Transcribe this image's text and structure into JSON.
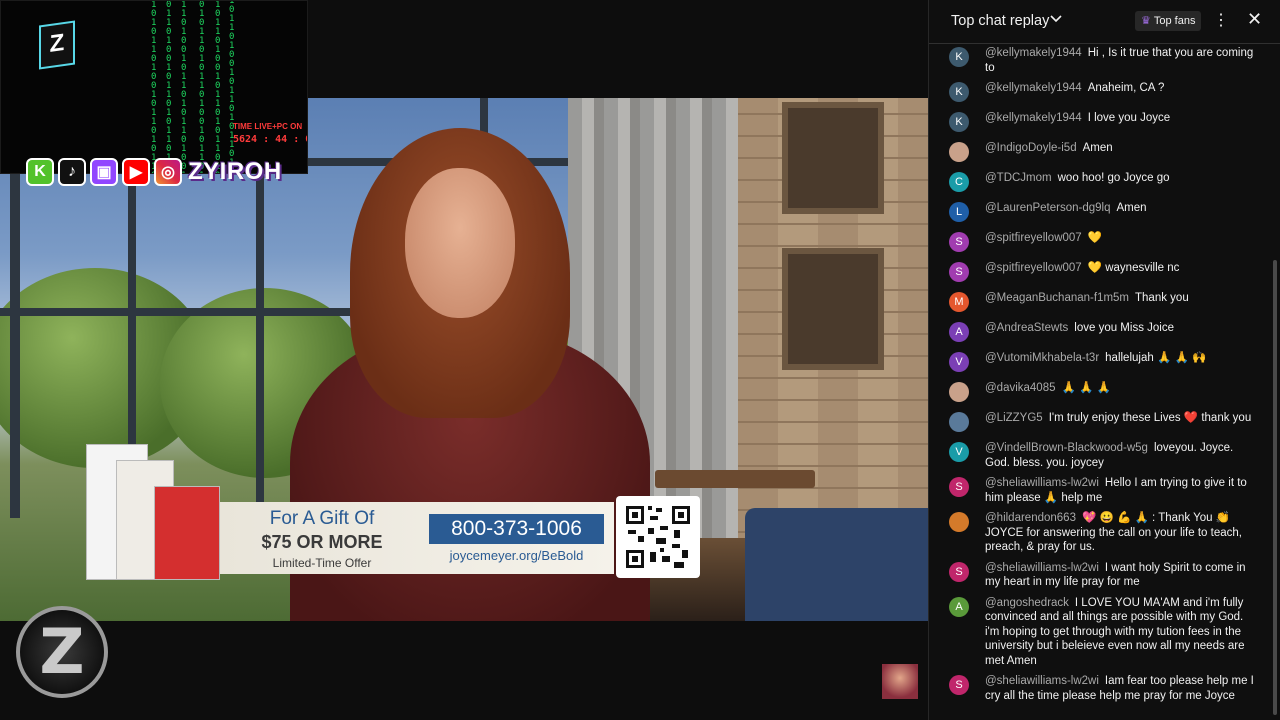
{
  "stream": {
    "live_label": "TIME LIVE+PC ON",
    "timer": "5624 : 44 : 06",
    "cam_logo": "Z",
    "socials": [
      "K",
      "♪",
      "▣",
      "▶",
      "◎"
    ],
    "handle": "ZYIROH",
    "bottom_logo": "Z"
  },
  "offer": {
    "line1": "For A Gift Of",
    "line2": "$75 OR MORE",
    "line3": "Limited-Time Offer",
    "phone": "800-373-1006",
    "site": "joycemeyer.org/BeBold"
  },
  "chat": {
    "title": "Top chat replay",
    "top_fans": "Top fans",
    "messages": [
      {
        "avatar": "K",
        "color": "#3d5a6e",
        "author": "@kellymakely1944",
        "text": "Hi , Is it true that you are coming to"
      },
      {
        "avatar": "K",
        "color": "#3d5a6e",
        "author": "@kellymakely1944",
        "text": "Anaheim, CA ?"
      },
      {
        "avatar": "K",
        "color": "#3d5a6e",
        "author": "@kellymakely1944",
        "text": "I love you Joyce"
      },
      {
        "avatar": "",
        "color": "#c9a18a",
        "author": "@IndigoDoyle-i5d",
        "text": "Amen"
      },
      {
        "avatar": "C",
        "color": "#1a9ca8",
        "author": "@TDCJmom",
        "text": "woo hoo! go Joyce go"
      },
      {
        "avatar": "L",
        "color": "#1f5fa8",
        "author": "@LaurenPeterson-dg9lq",
        "text": "Amen"
      },
      {
        "avatar": "S",
        "color": "#a13cb0",
        "author": "@spitfireyellow007",
        "text": "💛"
      },
      {
        "avatar": "S",
        "color": "#a13cb0",
        "author": "@spitfireyellow007",
        "text": "💛 waynesville nc"
      },
      {
        "avatar": "M",
        "color": "#e4572e",
        "author": "@MeaganBuchanan-f1m5m",
        "text": "Thank you"
      },
      {
        "avatar": "A",
        "color": "#7b3fb5",
        "author": "@AndreaStewts",
        "text": "love you Miss Joice"
      },
      {
        "avatar": "V",
        "color": "#7b3fb5",
        "author": "@VutomiMkhabela-t3r",
        "text": "hallelujah 🙏 🙏 🙌"
      },
      {
        "avatar": "",
        "color": "#c9a18a",
        "author": "@davika4085",
        "text": "🙏 🙏 🙏"
      },
      {
        "avatar": "",
        "color": "#5a7a9a",
        "author": "@LiZZYG5",
        "text": "I'm truly enjoy these Lives ❤️ thank you"
      },
      {
        "avatar": "V",
        "color": "#1a9ca8",
        "author": "@VindellBrown-Blackwood-w5g",
        "text": "loveyou. Joyce. God. bless. you. joycey"
      },
      {
        "avatar": "S",
        "color": "#c0266b",
        "author": "@sheliawilliams-lw2wi",
        "text": "Hello I am trying to give it to him please 🙏 help me"
      },
      {
        "avatar": "",
        "color": "#d47a2a",
        "author": "@hildarendon663",
        "text": "💖 😀 💪 🙏 : Thank You 👏 JOYCE for answering the call on your life to teach, preach, & pray for us."
      },
      {
        "avatar": "S",
        "color": "#c0266b",
        "author": "@sheliawilliams-lw2wi",
        "text": "I want holy Spirit to come in my heart in my life pray for me"
      },
      {
        "avatar": "A",
        "color": "#5a9a3a",
        "author": "@angoshedrack",
        "text": "I LOVE YOU MA'AM and i'm fully convinced and all things are possible with my God. i'm hoping to get through with my tution fees in the university but i beleieve even now all my needs are met Amen"
      },
      {
        "avatar": "S",
        "color": "#c0266b",
        "author": "@sheliawilliams-lw2wi",
        "text": "Iam fear too please help me I cry all the time please help me pray for me Joyce"
      }
    ]
  },
  "icons": {
    "chevron": "chevron-down-icon",
    "crown": "crown-icon",
    "more": "more-vert-icon",
    "close": "close-icon"
  }
}
